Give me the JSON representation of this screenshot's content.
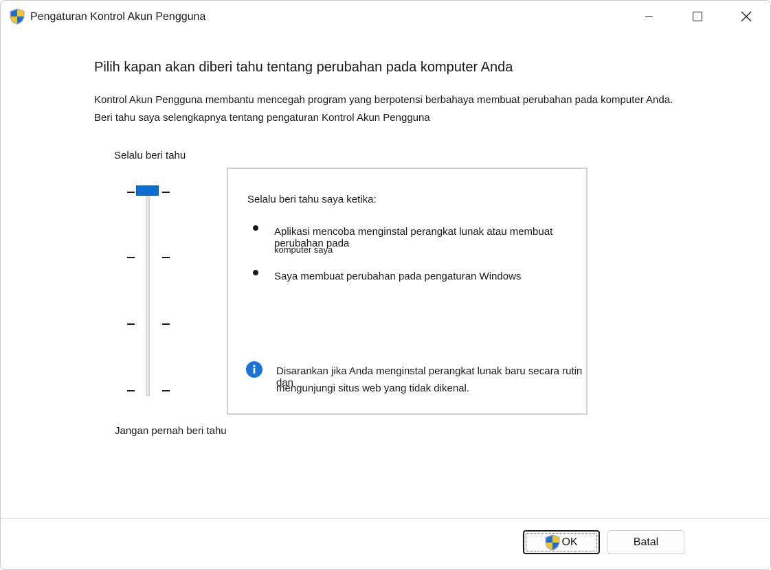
{
  "window": {
    "title": "Pengaturan Kontrol Akun Pengguna"
  },
  "content": {
    "heading": "Pilih kapan akan diberi tahu tentang perubahan pada komputer Anda",
    "description": "Kontrol Akun Pengguna membantu mencegah program yang berpotensi berbahaya membuat perubahan pada komputer Anda.",
    "learn_more": "Beri tahu saya selengkapnya tentang pengaturan Kontrol Akun Pengguna"
  },
  "slider": {
    "top_label": "Selalu beri tahu",
    "bottom_label": "Jangan pernah beri tahu",
    "levels": 4,
    "selected_level": 4
  },
  "info_box": {
    "title": "Selalu beri tahu saya ketika:",
    "items": [
      {
        "line1": "Aplikasi mencoba menginstal perangkat lunak atau membuat perubahan pada",
        "line2": "komputer saya"
      },
      {
        "line1": "Saya membuat perubahan pada pengaturan Windows"
      }
    ],
    "recommendation_line1": "Disarankan jika Anda menginstal perangkat lunak baru secara rutin dan",
    "recommendation_line2": "mengunjungi situs web yang tidak dikenal."
  },
  "buttons": {
    "ok_label": "OK",
    "cancel_label": "Batal"
  },
  "colors": {
    "accent": "#0a6ed1",
    "info": "#1a74d6"
  },
  "icons": {
    "title": "uac-shield-icon",
    "info": "info-icon",
    "ok": "uac-shield-icon"
  }
}
